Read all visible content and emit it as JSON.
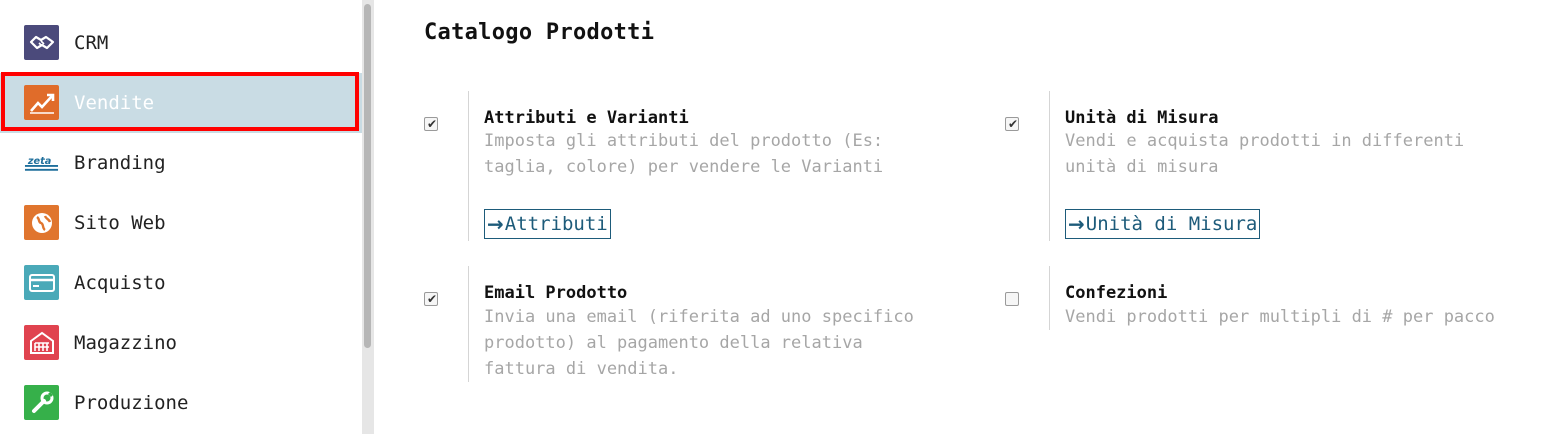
{
  "sidebar": {
    "items": [
      {
        "label": "CRM",
        "icon": "handshake-icon",
        "color": "#4b4a7b"
      },
      {
        "label": "Vendite",
        "icon": "sales-chart-icon",
        "color": "#e06c2a"
      },
      {
        "label": "Branding",
        "icon": "branding-logo-icon",
        "color": "#1f6f9c"
      },
      {
        "label": "Sito Web",
        "icon": "globe-icon",
        "color": "#e0752e"
      },
      {
        "label": "Acquisto",
        "icon": "credit-card-icon",
        "color": "#4aa9b8"
      },
      {
        "label": "Magazzino",
        "icon": "warehouse-icon",
        "color": "#e0434f"
      },
      {
        "label": "Produzione",
        "icon": "wrench-icon",
        "color": "#36b04a"
      }
    ],
    "active_index": 1
  },
  "main": {
    "title": "Catalogo Prodotti",
    "options": [
      {
        "title": "Attributi e Varianti",
        "desc_lines": [
          "Imposta gli attributi del prodotto (Es:",
          "taglia, colore) per vendere le Varianti"
        ],
        "checked": true,
        "link_label": "Attributi"
      },
      {
        "title": "Unità di Misura",
        "desc_lines": [
          "Vendi e acquista prodotti in differenti",
          "unità di misura"
        ],
        "checked": true,
        "link_label": "Unità di Misura"
      },
      {
        "title": "Email Prodotto",
        "desc_lines": [
          "Invia una email (riferita ad uno specifico",
          "prodotto) al pagamento della relativa",
          "fattura di vendita."
        ],
        "checked": true
      },
      {
        "title": "Confezioni",
        "desc_lines": [
          "Vendi prodotti per multipli di # per pacco"
        ],
        "checked": false
      }
    ]
  },
  "colors": {
    "accent": "#1d5b7a",
    "active_bg": "#c9dce4",
    "highlight": "#ff0000"
  }
}
